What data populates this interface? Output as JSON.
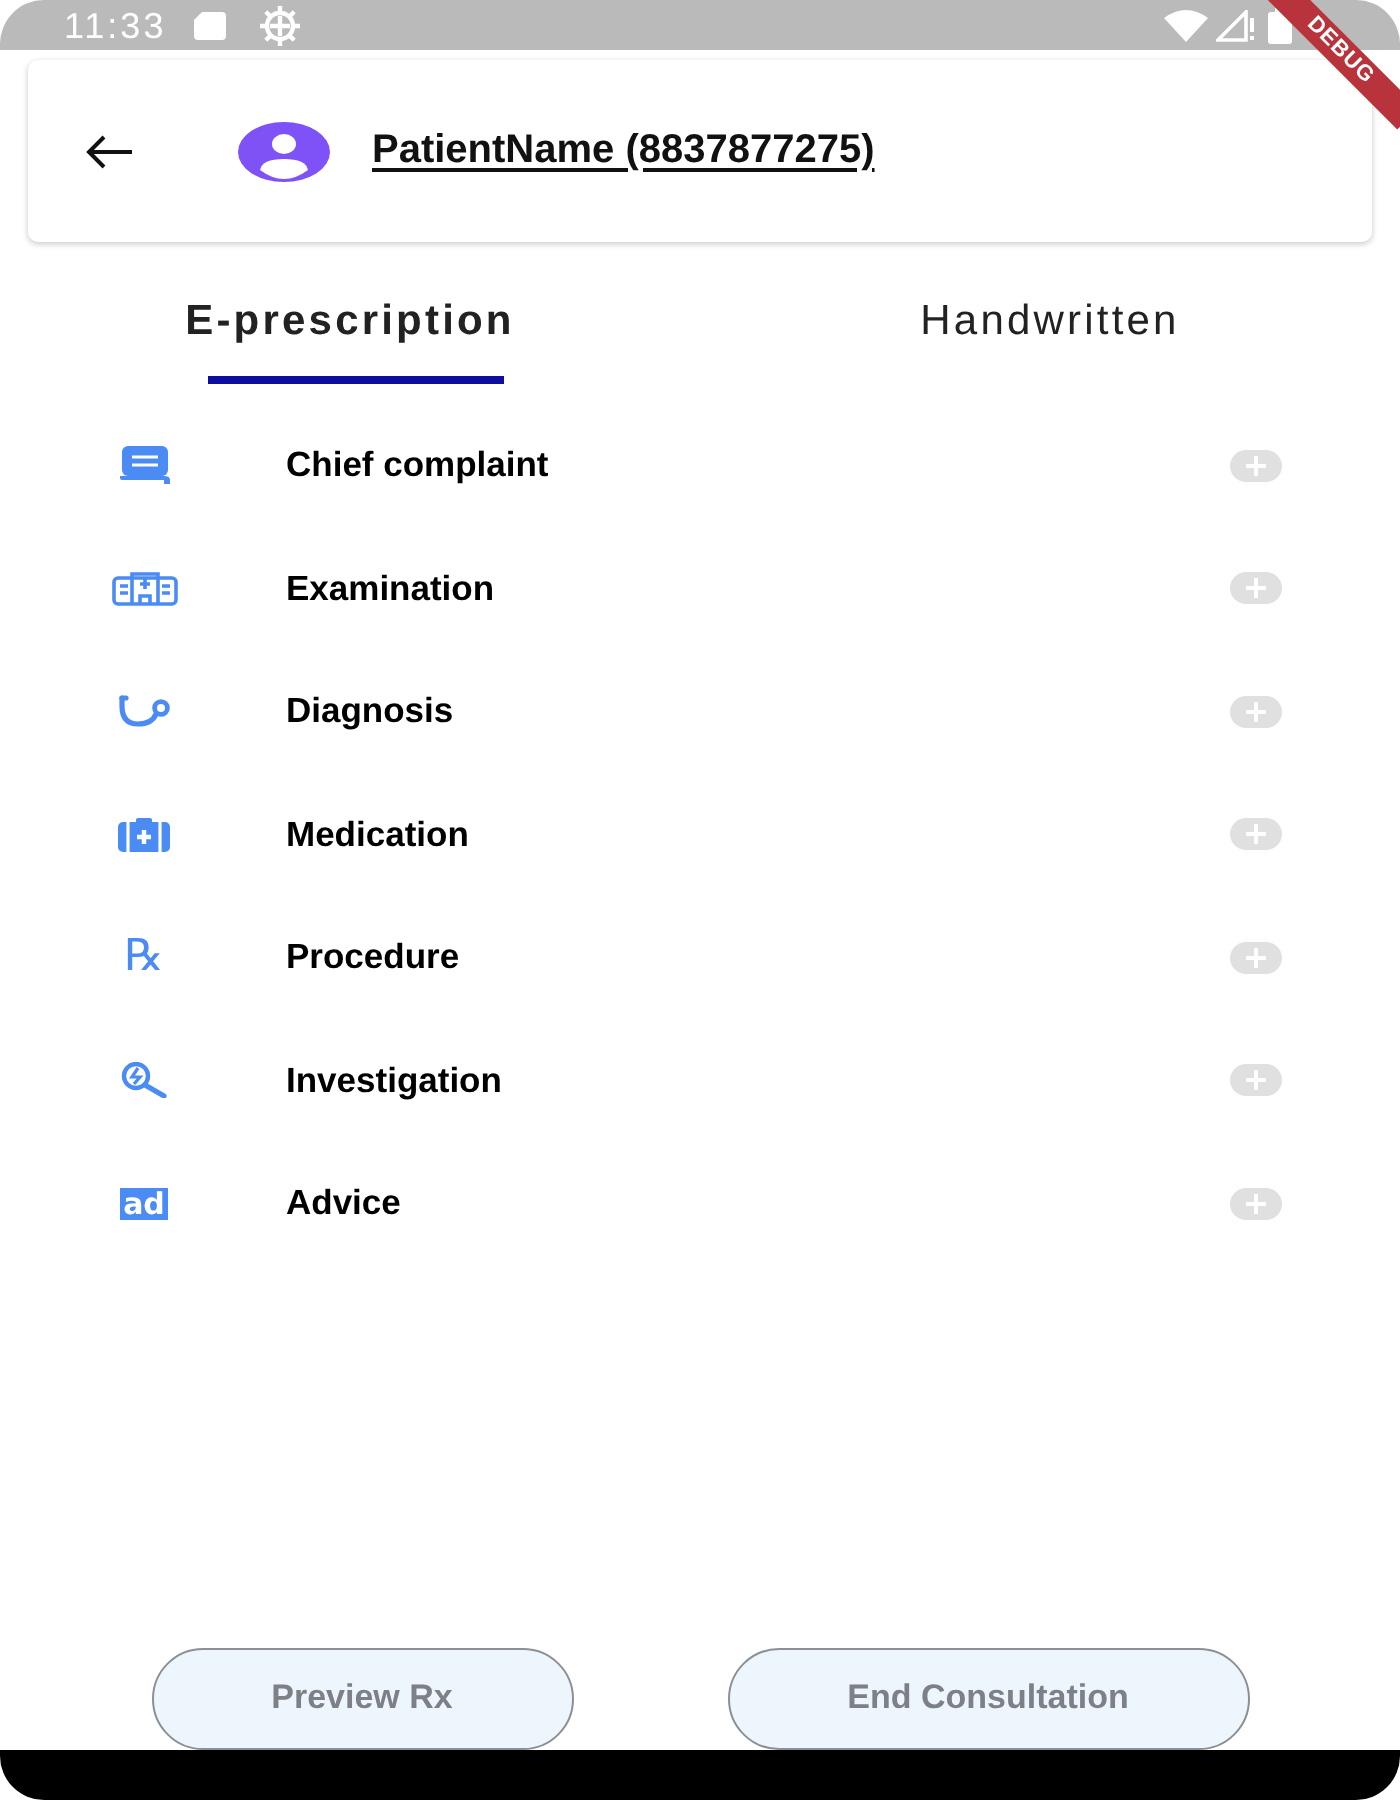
{
  "status_bar": {
    "time": "11:33"
  },
  "debug_banner": "DEBUG",
  "header": {
    "patient": "PatientName (8837877275)"
  },
  "tabs": [
    {
      "label": "E-prescription",
      "selected": true
    },
    {
      "label": "Handwritten",
      "selected": false
    }
  ],
  "sections": [
    {
      "kind": "complaint",
      "label": "Chief complaint"
    },
    {
      "kind": "examination",
      "label": "Examination"
    },
    {
      "kind": "diagnosis",
      "label": "Diagnosis"
    },
    {
      "kind": "medication",
      "label": "Medication"
    },
    {
      "kind": "procedure",
      "label": "Procedure",
      "symbol": "℞"
    },
    {
      "kind": "investigation",
      "label": "Investigation"
    },
    {
      "kind": "advice",
      "label": "Advice",
      "symbol": "ad"
    }
  ],
  "buttons": [
    "Preview Rx",
    "End Consultation"
  ]
}
